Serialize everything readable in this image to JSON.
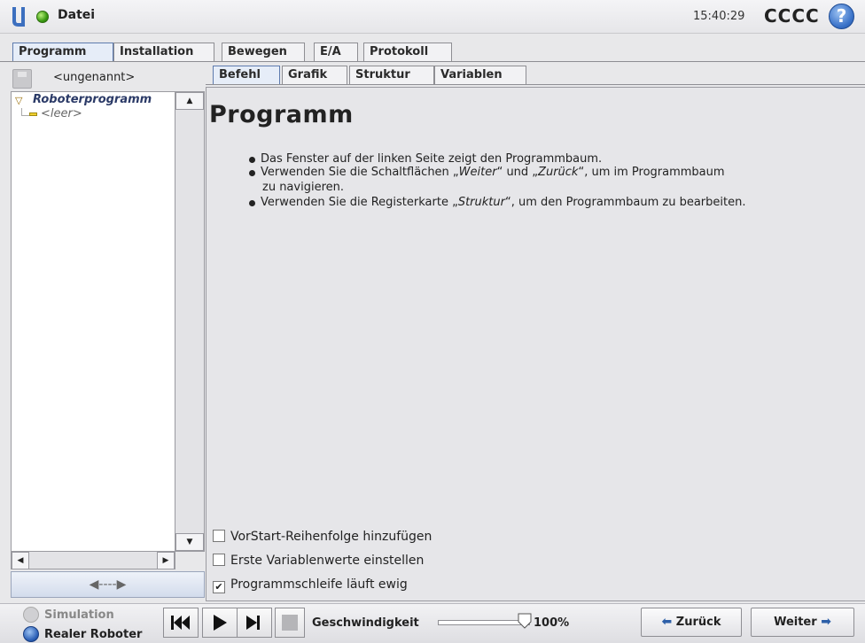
{
  "header": {
    "file_menu": "Datei",
    "clock": "15:40:29",
    "robot_name": "CCCC",
    "help": "?"
  },
  "main_tabs": [
    "Programm",
    "Installation",
    "Bewegen",
    "E/A",
    "Protokoll"
  ],
  "left_panel": {
    "program_name": "<ungenannt>",
    "tree_root": "Roboterprogramm",
    "tree_child": "<leer>",
    "nav_arrows": "◀----▶"
  },
  "sub_tabs": [
    "Befehl",
    "Grafik",
    "Struktur",
    "Variablen"
  ],
  "content": {
    "title": "Programm",
    "bullets": [
      "Das Fenster auf der linken Seite zeigt den Programmbaum.",
      "Verwenden Sie die Schaltflächen „Weiter“ und „Zurück“, um im Programmbaum",
      "Verwenden Sie die Registerkarte „Struktur“, um den Programmbaum zu bearbeiten."
    ],
    "bullet2_cont": "zu navigieren.",
    "bullet_emph": {
      "weiter": "Weiter",
      "zurueck": "Zurück",
      "struktur": "Struktur"
    },
    "checkboxes": [
      {
        "label": "VorStart-Reihenfolge hinzufügen",
        "checked": false
      },
      {
        "label": "Erste Variablenwerte einstellen",
        "checked": false
      },
      {
        "label": "Programmschleife läuft ewig",
        "checked": true
      }
    ]
  },
  "bottom": {
    "simulation": "Simulation",
    "real_robot": "Realer Roboter",
    "speed_label": "Geschwindigkeit",
    "speed_value": "100%",
    "speed_fraction": 1.0,
    "back_button": "Zurück",
    "next_button": "Weiter"
  },
  "colors": {
    "accent": "#2d5fa8",
    "status_ok": "#3a9a12",
    "tree_root": "#2b3a67"
  }
}
